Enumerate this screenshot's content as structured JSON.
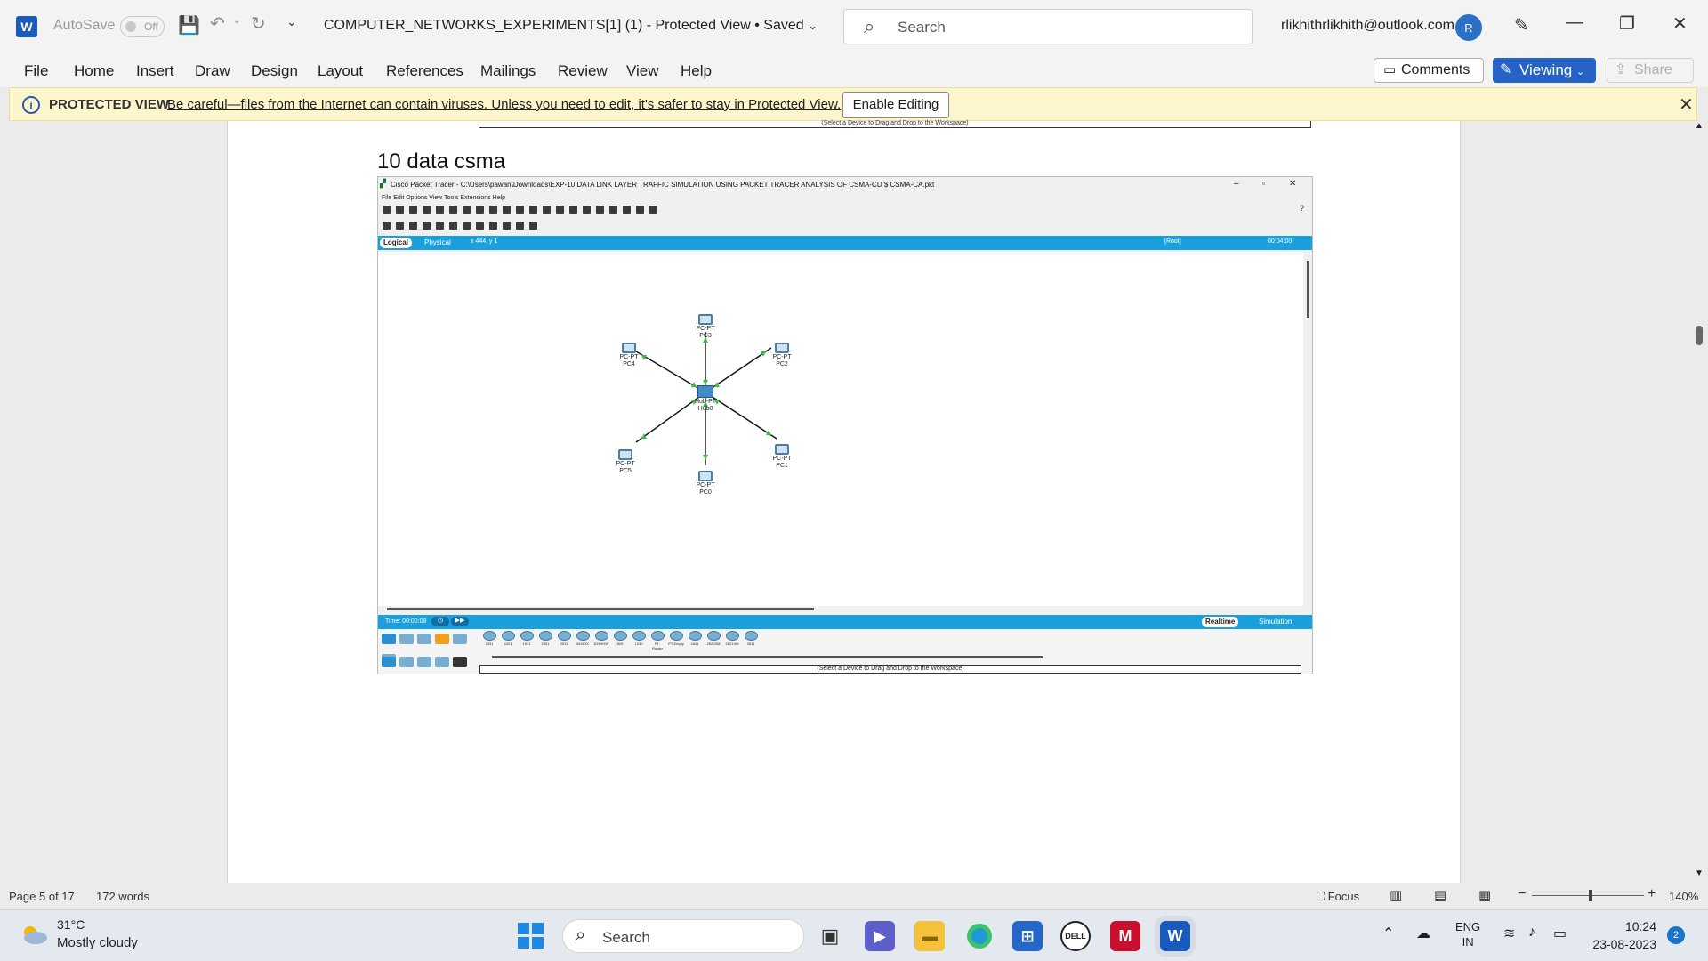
{
  "titlebar": {
    "app_letter": "W",
    "autosave_label": "AutoSave",
    "autosave_state": "Off",
    "document_title": "COMPUTER_NETWORKS_EXPERIMENTS[1] (1)  -  Protected View • Saved",
    "search_placeholder": "Search",
    "account_email": "rlikhithrlikhith@outlook.com",
    "avatar_initial": "R"
  },
  "menu": {
    "items": [
      "File",
      "Home",
      "Insert",
      "Draw",
      "Design",
      "Layout",
      "References",
      "Mailings",
      "Review",
      "View",
      "Help"
    ],
    "comments_label": "Comments",
    "viewing_label": "Viewing",
    "share_label": "Share"
  },
  "protected_view": {
    "label": "PROTECTED VIEW",
    "message": "Be careful—files from the Internet can contain viruses. Unless you need to edit, it's safer to stay in Protected View.",
    "enable_button": "Enable Editing"
  },
  "document": {
    "prev_strip_text": "(Select a Device to Drag and Drop to the Workspace)",
    "heading": "10 data csma",
    "packet_tracer": {
      "window_title": "Cisco Packet Tracer - C:\\Users\\pawan\\Downloads\\EXP-10 DATA LINK LAYER TRAFFIC SIMULATION USING PACKET TRACER ANALYSIS OF CSMA-CD $ CSMA-CA.pkt",
      "menu": "File   Edit   Options   View   Tools   Extensions   Help",
      "logical_tab": "Logical",
      "physical_tab": "Physical",
      "coords": "x 444, y 1",
      "root_label": "[Root]",
      "clock": "00:04:00",
      "time_label": "Time: 00:00:08",
      "realtime_label": "Realtime",
      "simulation_label": "Simulation",
      "help_mark": "?",
      "hint": "(Select a Device to Drag and Drop to the Workspace)",
      "device_labels": [
        "4331",
        "4321",
        "1941",
        "2901",
        "2911",
        "819IOX",
        "819HGW",
        "829",
        "1240",
        "PT-Router",
        "PT-Empty",
        "1841",
        "2620XM",
        "2621XM",
        "2811"
      ],
      "nodes": {
        "hub": {
          "type": "Hub-PT",
          "name": "Hub0"
        },
        "pc0": {
          "type": "PC-PT",
          "name": "PC0"
        },
        "pc1": {
          "type": "PC-PT",
          "name": "PC1"
        },
        "pc2": {
          "type": "PC-PT",
          "name": "PC2"
        },
        "pc3": {
          "type": "PC-PT",
          "name": "PC3"
        },
        "pc4": {
          "type": "PC-PT",
          "name": "PC4"
        },
        "pc5": {
          "type": "PC-PT",
          "name": "PC5"
        }
      }
    }
  },
  "statusbar": {
    "page": "Page 5 of 17",
    "words": "172 words",
    "focus": "Focus",
    "zoom": "140%"
  },
  "taskbar": {
    "temperature": "31°C",
    "weather": "Mostly cloudy",
    "search_placeholder": "Search",
    "lang_line1": "ENG",
    "lang_line2": "IN",
    "time": "10:24",
    "date": "23-08-2023",
    "notifications": "2"
  },
  "colors": {
    "accent": "#2763c6",
    "word_blue": "#185abd",
    "pt_blue": "#1aa0dd",
    "pv_yellow": "#fdf6cd"
  }
}
